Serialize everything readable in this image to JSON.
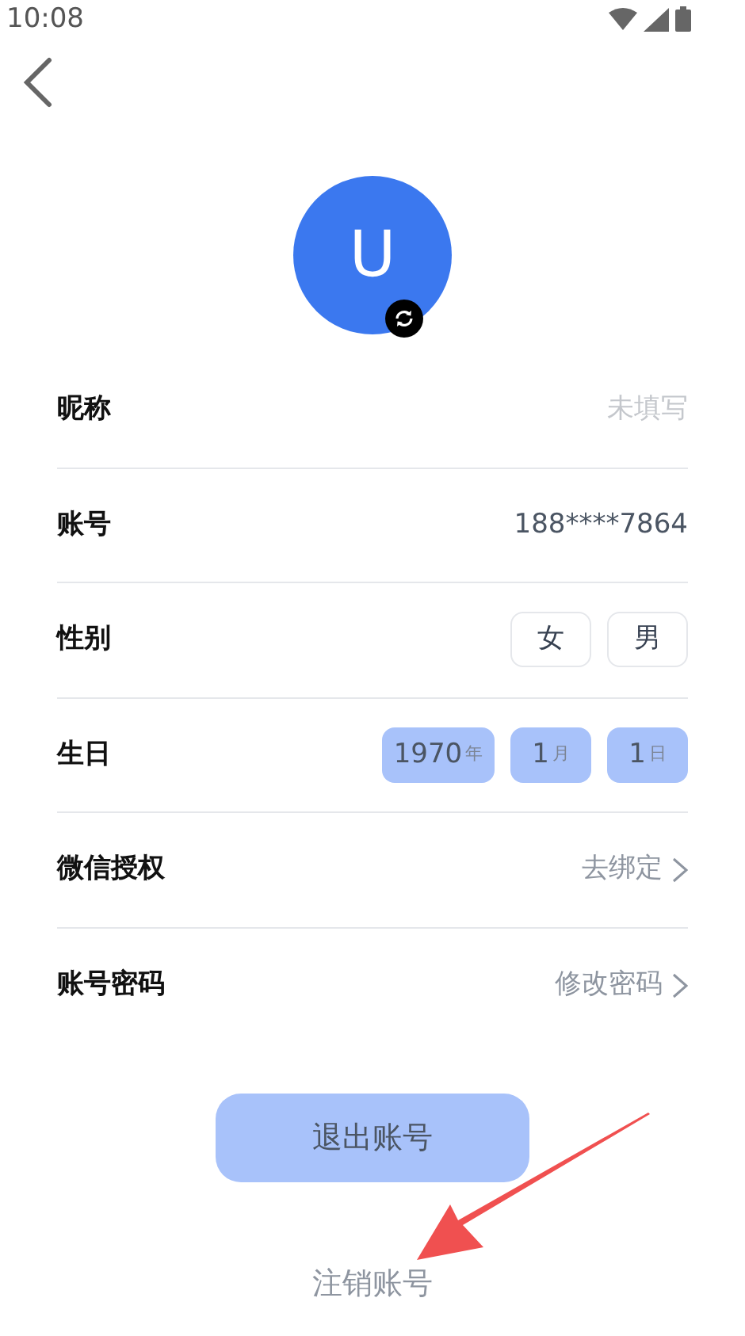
{
  "status_bar": {
    "time": "10:08"
  },
  "avatar": {
    "initial": "U"
  },
  "rows": [
    {
      "kind": "text",
      "label": "昵称",
      "value": "未填写",
      "empty": true
    },
    {
      "kind": "text",
      "label": "账号",
      "value": "188****7864",
      "empty": false
    },
    {
      "kind": "options",
      "label": "性别",
      "options": [
        {
          "label": "女",
          "selected": false
        },
        {
          "label": "男",
          "selected": false
        }
      ]
    },
    {
      "kind": "date",
      "label": "生日",
      "parts": [
        {
          "value": "1970",
          "unit": "年"
        },
        {
          "value": "1",
          "unit": "月"
        },
        {
          "value": "1",
          "unit": "日"
        }
      ]
    },
    {
      "kind": "link",
      "label": "微信授权",
      "value": "去绑定"
    },
    {
      "kind": "link",
      "label": "账号密码",
      "value": "修改密码"
    }
  ],
  "logout_button": "退出账号",
  "delete_account_link": "注销账号"
}
